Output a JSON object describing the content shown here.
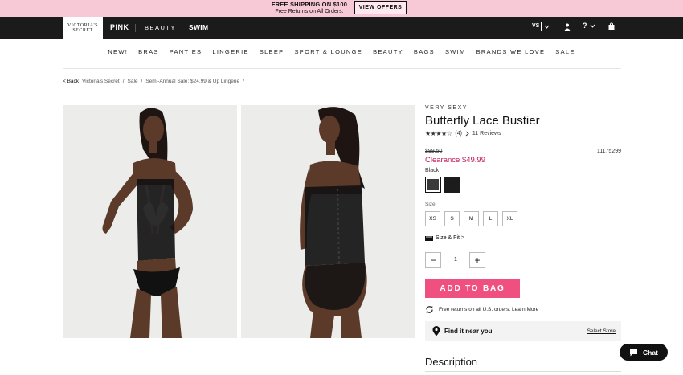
{
  "promo": {
    "line1": "FREE SHIPPING ON $100",
    "line2": "Free Returns on All Orders.",
    "button": "VIEW OFFERS"
  },
  "topbar": {
    "logo_line1": "VICTORIA'S",
    "logo_line2": "SECRET",
    "brand_pink": "PINK",
    "brand_beauty": "BEAUTY",
    "brand_swim": "SWIM",
    "account_badge": "VS",
    "help_label": "?"
  },
  "nav": {
    "items": [
      "NEW!",
      "BRAS",
      "PANTIES",
      "LINGERIE",
      "SLEEP",
      "SPORT & LOUNGE",
      "BEAUTY",
      "BAGS",
      "SWIM",
      "BRANDS WE LOVE",
      "SALE"
    ]
  },
  "breadcrumb": {
    "back": "< Back",
    "items": [
      "Victoria's Secret",
      "/",
      "Sale",
      "/",
      "Semi-Annual Sale: $24.99 & Up Lingerie",
      "/"
    ]
  },
  "product": {
    "subtitle": "VERY SEXY",
    "title": "Butterfly Lace Bustier",
    "stars": "★★★★☆",
    "rating_value": 4,
    "rating_count": "(4)",
    "reviews_link": "11 Reviews",
    "original_price": "$99.50",
    "item_number": "11175299",
    "sale_price": "Clearance $49.99",
    "color_label": "Black",
    "swatch_colors": [
      "#3a3a3a",
      "#1c1c1c"
    ],
    "size_label": "Size",
    "sizes": [
      "XS",
      "S",
      "M",
      "L",
      "XL"
    ],
    "size_fit": "Size & Fit >",
    "qty_minus": "−",
    "qty_value": "1",
    "qty_plus": "+",
    "add_to_bag": "ADD TO BAG",
    "returns_text": "Free returns on all U.S. orders.",
    "learn_more": "Learn More",
    "find_store": "Find it near you",
    "select_store": "Select Store",
    "description_title": "Description"
  },
  "chat": {
    "label": "Chat"
  },
  "colors": {
    "accent": "#f0507f",
    "sale": "#c2185b",
    "promo_bg": "#f7c9d6",
    "topbar": "#1b1b1b"
  }
}
